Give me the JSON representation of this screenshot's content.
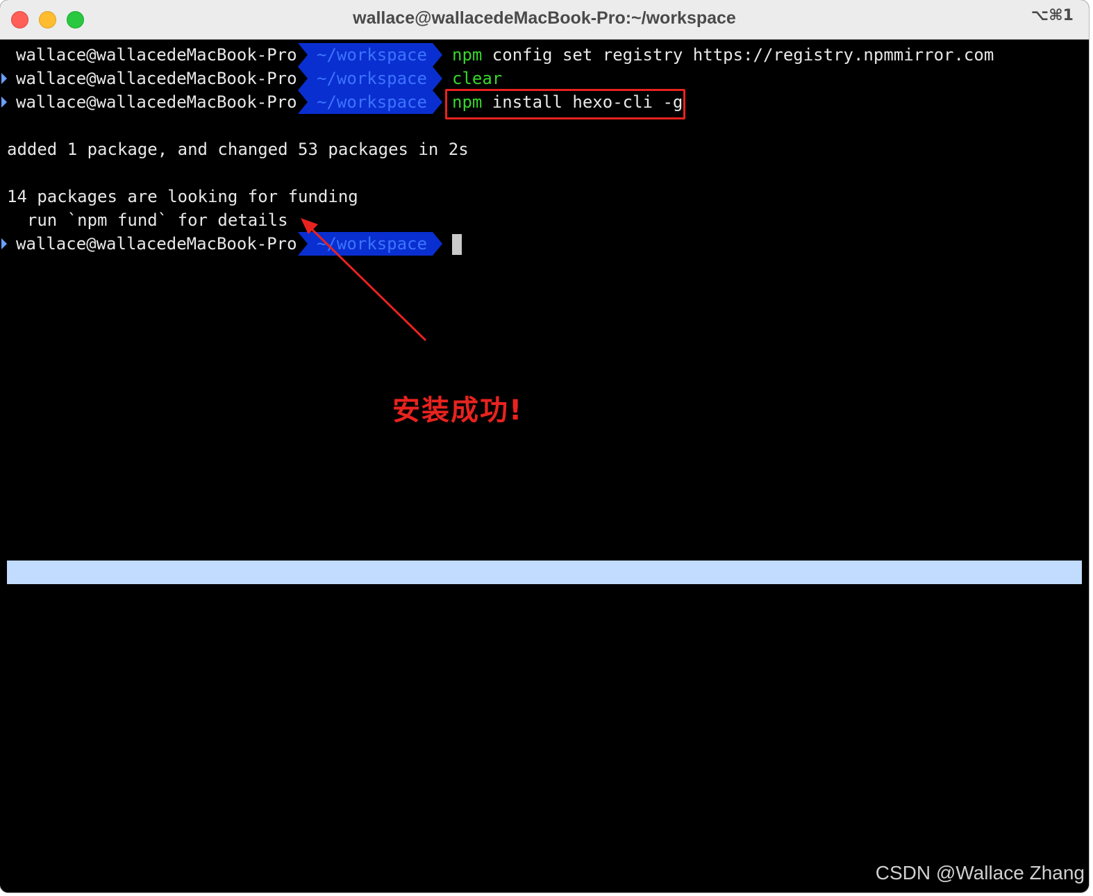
{
  "window": {
    "title": "wallace@wallacedeMacBook-Pro:~/workspace",
    "shortcut": "⌥⌘1",
    "controls": [
      "close-icon",
      "minimize-icon",
      "zoom-icon"
    ]
  },
  "terminal": {
    "prompts": [
      {
        "user": "wallace@wallacedeMacBook-Pro",
        "dir": "~/workspace",
        "cmd_name": "npm",
        "cmd_rest": " config set registry https://registry.npmmirror.com"
      },
      {
        "user": "wallace@wallacedeMacBook-Pro",
        "dir": "~/workspace",
        "cmd_name": "clear",
        "cmd_rest": ""
      },
      {
        "user": "wallace@wallacedeMacBook-Pro",
        "dir": "~/workspace",
        "cmd_name": "npm",
        "cmd_rest": " install hexo-cli -g"
      },
      {
        "user": "wallace@wallacedeMacBook-Pro",
        "dir": "~/workspace",
        "cmd_name": "",
        "cmd_rest": ""
      }
    ],
    "output": [
      "added 1 package, and changed 53 packages in 2s",
      "14 packages are looking for funding",
      "  run `npm fund` for details"
    ]
  },
  "annotation": {
    "text": "安装成功!",
    "color": "#e8231f"
  },
  "colors": {
    "command_green": "#38d52c",
    "dir_bg": "#0a2fd0",
    "dir_text": "#3c74ff",
    "highlight_bar": "#c1dcff"
  },
  "watermark": "CSDN @Wallace Zhang"
}
